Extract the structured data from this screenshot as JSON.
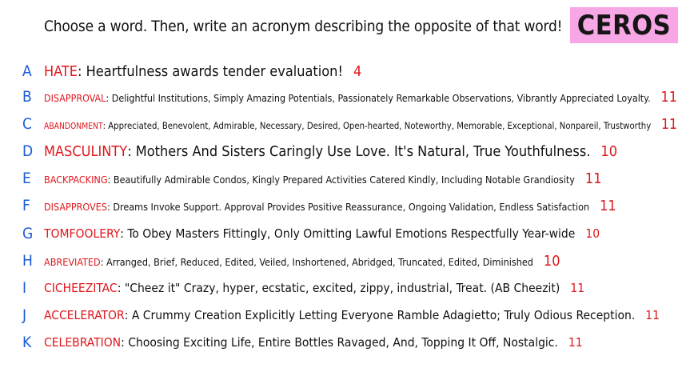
{
  "prompt": "Choose a word. Then, write an acronym describing the opposite of that word!",
  "logo": "CEROS",
  "colors": {
    "letter": "#1a5bd6",
    "word": "#e0161b",
    "logo_bg": "#f7a6e6"
  },
  "rows": [
    {
      "letter": "A",
      "word": "HATE",
      "text": ":  Heartfulness awards tender evaluation!",
      "score": "4"
    },
    {
      "letter": "B",
      "word": "DISAPPROVAL",
      "text": ":  Delightful Institutions, Simply Amazing Potentials, Passionately Remarkable Observations, Vibrantly Appreciated Loyalty.",
      "score": "11"
    },
    {
      "letter": "C",
      "word": "ABANDONMENT",
      "text": ":  Appreciated, Benevolent, Admirable, Necessary, Desired, Open-hearted, Noteworthy, Memorable, Exceptional, Nonpareil, Trustworthy",
      "score": "11"
    },
    {
      "letter": "D",
      "word": "MASCULINTY",
      "text": ":  Mothers And Sisters Caringly Use Love. It's Natural, True Youthfulness.",
      "score": "10"
    },
    {
      "letter": "E",
      "word": "BACKPACKING",
      "text": ":  Beautifully Admirable Condos, Kingly Prepared Activities Catered Kindly, Including Notable Grandiosity",
      "score": "11"
    },
    {
      "letter": "F",
      "word": "DISAPPROVES",
      "text": ":  Dreams Invoke Support. Approval Provides Positive Reassurance, Ongoing Validation, Endless Satisfaction",
      "score": "11"
    },
    {
      "letter": "G",
      "word": "TOMFOOLERY",
      "text": ":  To Obey Masters Fittingly, Only Omitting Lawful Emotions Respectfully Year-wide",
      "score": "10"
    },
    {
      "letter": "H",
      "word": "ABREVIATED",
      "text": ":  Arranged, Brief, Reduced, Edited, Veiled, Inshortened, Abridged, Truncated, Edited, Diminished",
      "score": "10"
    },
    {
      "letter": "I",
      "word": "CICHEEZITAC",
      "text": ":  \"Cheez it\" Crazy, hyper, ecstatic, excited, zippy, industrial, Treat. (AB Cheezit)",
      "score": "11"
    },
    {
      "letter": "J",
      "word": "ACCELERATOR",
      "text": ":  A Crummy Creation Explicitly Letting Everyone Ramble Adagietto; Truly Odious Reception.",
      "score": "11"
    },
    {
      "letter": "K",
      "word": "CELEBRATION",
      "text": ":  Choosing Exciting Life, Entire Bottles Ravaged, And, Topping It Off, Nostalgic.",
      "score": "11"
    }
  ]
}
